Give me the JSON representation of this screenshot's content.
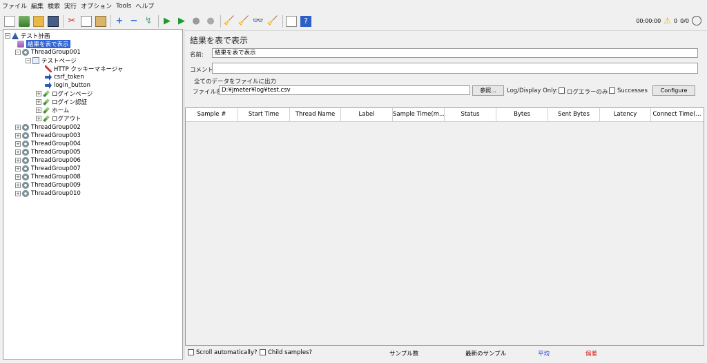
{
  "menu": [
    "ファイル",
    "編集",
    "検索",
    "実行",
    "オプション",
    "Tools",
    "ヘルプ"
  ],
  "toolbar": {
    "timer": "00:00:00",
    "warning_count": "0",
    "threads": "0/0"
  },
  "tree": {
    "test_plan": "テスト計画",
    "selected_item": "結果を表で表示",
    "thread_group_1": "ThreadGroup001",
    "test_page": "テストページ",
    "cookie_manager": "HTTP クッキーマネージャ",
    "csrf_token": "csrf_token",
    "login_button": "login_button",
    "login_page": "ログインページ",
    "login_auth": "ログイン認証",
    "home": "ホーム",
    "logout": "ログアウト",
    "other_groups": [
      "ThreadGroup002",
      "ThreadGroup003",
      "ThreadGroup004",
      "ThreadGroup005",
      "ThreadGroup006",
      "ThreadGroup007",
      "ThreadGroup008",
      "ThreadGroup009",
      "ThreadGroup010"
    ]
  },
  "panel": {
    "title": "結果を表で表示",
    "name_label": "名前:",
    "name_value": "結果を表で表示",
    "comment_label": "コメント",
    "comment_value": "",
    "output_section": "全てのデータをファイルに出力",
    "filename_label": "ファイル名",
    "filename_value": "D:¥jmeter¥log¥test.csv",
    "browse_button": "参照...",
    "log_display_label": "Log/Display Only:",
    "errors_only": "ログエラーのみ",
    "successes": "Successes",
    "configure_button": "Configure"
  },
  "table": {
    "columns": [
      "Sample #",
      "Start Time",
      "Thread Name",
      "Label",
      "Sample Time(m...",
      "Status",
      "Bytes",
      "Sent Bytes",
      "Latency",
      "Connect Time(..."
    ]
  },
  "footer": {
    "scroll_auto": "Scroll automatically?",
    "child_samples": "Child samples?",
    "sample_count": "サンプル数",
    "latest_sample": "最新のサンプル",
    "average": "平均",
    "deviation": "偏差",
    "average_color": "#1f3fd6",
    "deviation_color": "#d62020"
  }
}
